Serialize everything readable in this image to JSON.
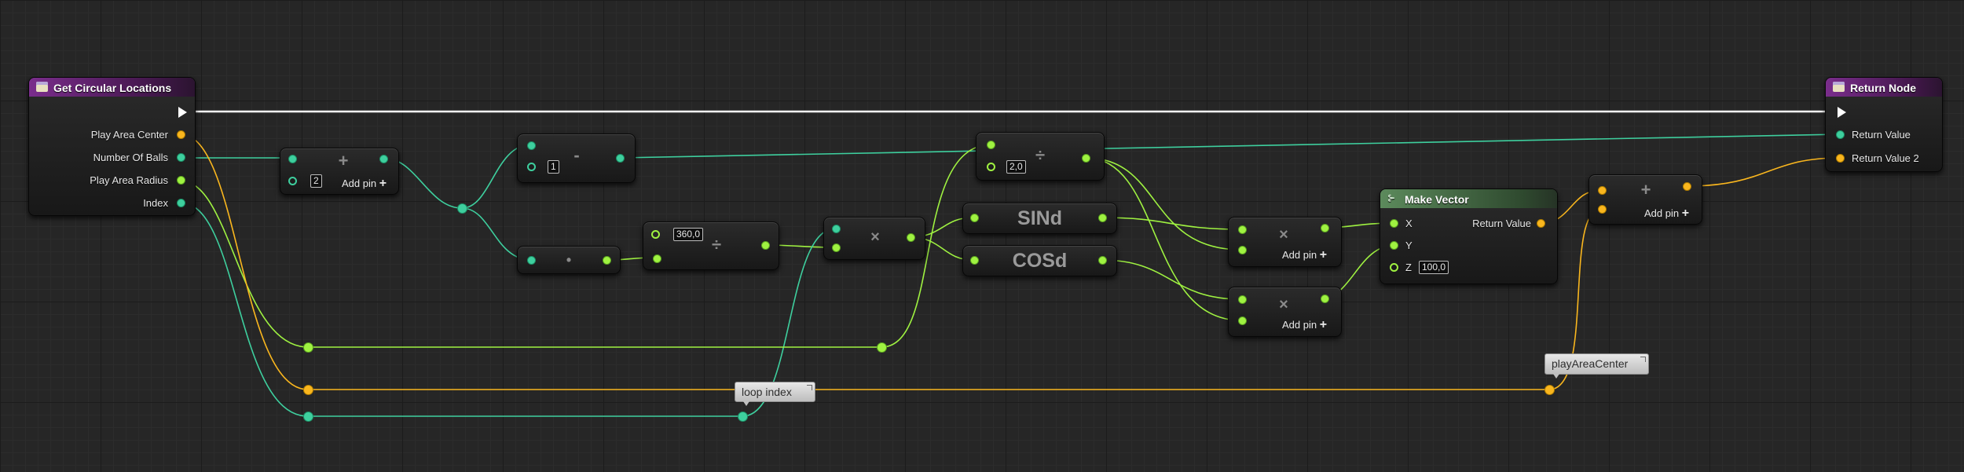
{
  "colors": {
    "float_pin": "#9ff241",
    "int_pin": "#3ecf9e",
    "vector_pin": "#f9b61e",
    "exec_wire": "#ffffff",
    "entry_header": "#7a2d8c",
    "make_vector_header": "#5c8a5c"
  },
  "icons": {
    "function_entry": "function-icon",
    "return_node": "return-icon",
    "make_vector": "struct-icon",
    "comment_collapse": "collapse-icon"
  },
  "entry_node": {
    "title": "Get Circular Locations",
    "outputs": [
      "Play Area Center",
      "Number Of Balls",
      "Play Area Radius",
      "Index"
    ]
  },
  "return_node": {
    "title": "Return Node",
    "inputs": [
      "Return Value",
      "Return Value 2"
    ]
  },
  "add_int_node": {
    "operator": "+",
    "default_value": "2",
    "add_pin_label": "Add pin",
    "add_pin_icon": "+"
  },
  "subtract_node": {
    "operator": "-",
    "default_value": "1"
  },
  "conversion_node": {
    "operator": "•"
  },
  "divide_360_node": {
    "operator": "÷",
    "default_value": "360,0"
  },
  "multiply_angle_node": {
    "operator": "×"
  },
  "divide_2_node": {
    "operator": "÷",
    "default_value": "2,0"
  },
  "sind_node": {
    "label": "SINd"
  },
  "cosd_node": {
    "label": "COSd"
  },
  "multiply_x_node": {
    "operator": "×",
    "add_pin_label": "Add pin",
    "add_pin_icon": "+"
  },
  "multiply_y_node": {
    "operator": "×",
    "add_pin_label": "Add pin",
    "add_pin_icon": "+"
  },
  "make_vector_node": {
    "title": "Make Vector",
    "inputs": [
      "X",
      "Y",
      "Z"
    ],
    "z_default": "100,0",
    "output": "Return Value"
  },
  "add_vector_node": {
    "operator": "+",
    "add_pin_label": "Add pin",
    "add_pin_icon": "+"
  },
  "comments": {
    "loop_index": "loop index",
    "play_area_center": "playAreaCenter"
  }
}
